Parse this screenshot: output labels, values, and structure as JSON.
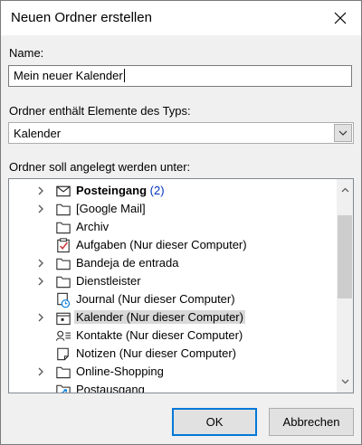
{
  "dialog": {
    "title": "Neuen Ordner erstellen",
    "name_label": "Name:",
    "name_value": "Mein neuer Kalender",
    "type_label": "Ordner enthält Elemente des Typs:",
    "type_value": "Kalender",
    "location_label": "Ordner soll angelegt werden unter:",
    "ok_label": "OK",
    "cancel_label": "Abbrechen"
  },
  "tree": {
    "items": [
      {
        "label": "Posteingang",
        "count": "(2)",
        "icon": "mail-icon",
        "expandable": true,
        "bold": true,
        "selected": false
      },
      {
        "label": "[Google Mail]",
        "icon": "folder-icon",
        "expandable": true,
        "bold": false,
        "selected": false
      },
      {
        "label": "Archiv",
        "icon": "folder-icon",
        "expandable": false,
        "bold": false,
        "selected": false
      },
      {
        "label": "Aufgaben (Nur dieser Computer)",
        "icon": "tasks-icon",
        "expandable": false,
        "bold": false,
        "selected": false
      },
      {
        "label": "Bandeja de entrada",
        "icon": "folder-icon",
        "expandable": true,
        "bold": false,
        "selected": false
      },
      {
        "label": "Dienstleister",
        "icon": "folder-icon",
        "expandable": true,
        "bold": false,
        "selected": false
      },
      {
        "label": "Journal (Nur dieser Computer)",
        "icon": "journal-icon",
        "expandable": false,
        "bold": false,
        "selected": false
      },
      {
        "label": "Kalender (Nur dieser Computer)",
        "icon": "calendar-icon",
        "expandable": true,
        "bold": false,
        "selected": true
      },
      {
        "label": "Kontakte (Nur dieser Computer)",
        "icon": "contacts-icon",
        "expandable": false,
        "bold": false,
        "selected": false
      },
      {
        "label": "Notizen (Nur dieser Computer)",
        "icon": "notes-icon",
        "expandable": false,
        "bold": false,
        "selected": false
      },
      {
        "label": "Online-Shopping",
        "icon": "folder-icon",
        "expandable": true,
        "bold": false,
        "selected": false
      },
      {
        "label": "Postausgang",
        "icon": "outbox-icon",
        "expandable": false,
        "bold": false,
        "selected": false
      }
    ]
  },
  "colors": {
    "accent": "#0078d7",
    "selection": "#d9d9d9",
    "count": "#0033bb",
    "dialog_bg": "#f0f0f0"
  }
}
